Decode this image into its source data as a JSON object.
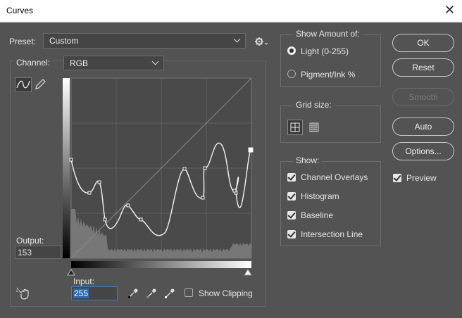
{
  "window": {
    "title": "Curves",
    "close_glyph": "✕"
  },
  "preset": {
    "label": "Preset:",
    "value": "Custom"
  },
  "channel": {
    "label": "Channel:",
    "value": "RGB"
  },
  "output": {
    "label": "Output:",
    "value": "153"
  },
  "input": {
    "label": "Input:",
    "value": "255"
  },
  "show_clipping": {
    "label": "Show Clipping",
    "checked": false
  },
  "show_amount": {
    "title": "Show Amount of:",
    "light": {
      "label": "Light  (0-255)",
      "selected": true
    },
    "pigment": {
      "label": "Pigment/Ink %",
      "selected": false
    }
  },
  "grid_size": {
    "title": "Grid size:"
  },
  "show": {
    "title": "Show:",
    "items": [
      {
        "label": "Channel Overlays",
        "checked": true
      },
      {
        "label": "Histogram",
        "checked": true
      },
      {
        "label": "Baseline",
        "checked": true
      },
      {
        "label": "Intersection Line",
        "checked": true
      }
    ]
  },
  "buttons": {
    "ok": "OK",
    "reset": "Reset",
    "smooth": "Smooth",
    "auto": "Auto",
    "options": "Options..."
  },
  "preview": {
    "label": "Preview",
    "checked": true
  },
  "colors": {
    "dialog_bg": "#535353",
    "graph_bg": "#4a4a4a",
    "input_highlight": "#2a6ab0"
  }
}
